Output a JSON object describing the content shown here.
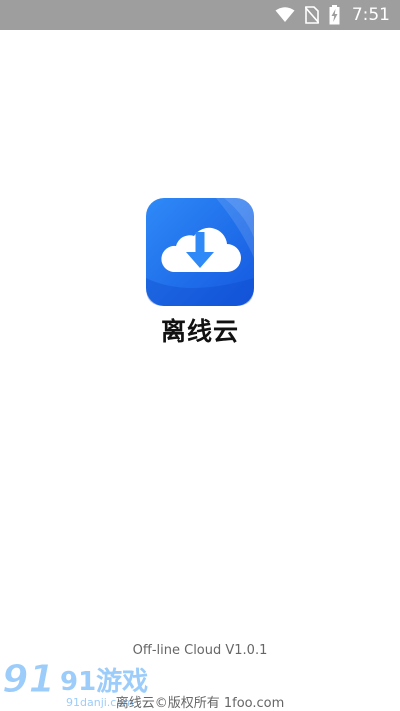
{
  "status_bar": {
    "time": "7:51",
    "icons": [
      "wifi-icon",
      "no-sim-icon",
      "battery-charging-icon"
    ]
  },
  "app": {
    "name": "离线云",
    "icon": "cloud-download-icon"
  },
  "footer": {
    "version": "Off-line Cloud V1.0.1",
    "copyright": "离线云©版权所有 1foo.com"
  },
  "watermark": {
    "text": "91游戏",
    "site": "91danji.com"
  },
  "colors": {
    "status_bar": "#9e9e9e",
    "icon_blue": "#1e63e8",
    "icon_blue_light": "#2f8af7",
    "text_dark": "#111111",
    "text_muted": "#666666"
  }
}
